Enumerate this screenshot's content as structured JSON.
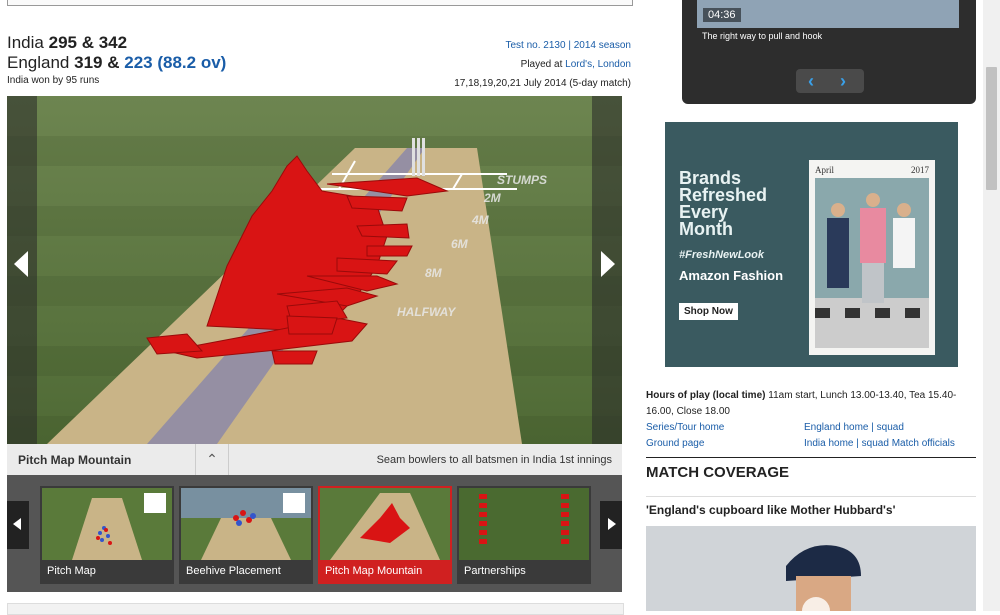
{
  "scorecard": {
    "team1": {
      "name": "India",
      "score": "295 & 342"
    },
    "team2": {
      "name": "England",
      "score1": "319 &",
      "score2": "223",
      "overs": "(88.2 ov)"
    },
    "result": "India won by 95 runs"
  },
  "match_meta": {
    "test_no": "Test no. 2130",
    "separator": "|",
    "season": "2014 season",
    "played_at_prefix": "Played at",
    "venue": "Lord's, London",
    "dates": "17,18,19,20,21 July 2014 (5-day match)"
  },
  "visualization": {
    "pitch_markers": [
      "STUMPS",
      "2M",
      "4M",
      "6M",
      "8M",
      "HALFWAY"
    ],
    "title": "Pitch Map Mountain",
    "description": "Seam bowlers to all batsmen in India 1st innings"
  },
  "thumbnails": [
    {
      "label": "Pitch Map",
      "active": false
    },
    {
      "label": "Beehive Placement",
      "active": false
    },
    {
      "label": "Pitch Map Mountain",
      "active": true
    },
    {
      "label": "Partnerships",
      "active": false
    }
  ],
  "video": {
    "duration": "04:36",
    "title": "The right way to pull and hook"
  },
  "ad": {
    "headline_lines": [
      "Brands",
      "Refreshed",
      "Every",
      "Month"
    ],
    "hashtag": "#FreshNewLook",
    "brand": "Amazon Fashion",
    "cta": "Shop Now",
    "month": "April",
    "year": "2017"
  },
  "info": {
    "hours_label": "Hours of play (local time)",
    "hours_text": "11am start, Lunch 13.00-13.40, Tea 15.40-16.00, Close 18.00",
    "links_col1": [
      "Series/Tour home",
      "Ground page"
    ],
    "england_home": "England home",
    "england_squad": "squad",
    "india_home": "India home",
    "india_squad": "squad",
    "match_officials": "Match officials"
  },
  "coverage": {
    "heading": "MATCH COVERAGE",
    "story_title": "'England's cupboard like Mother Hubbard's'"
  }
}
